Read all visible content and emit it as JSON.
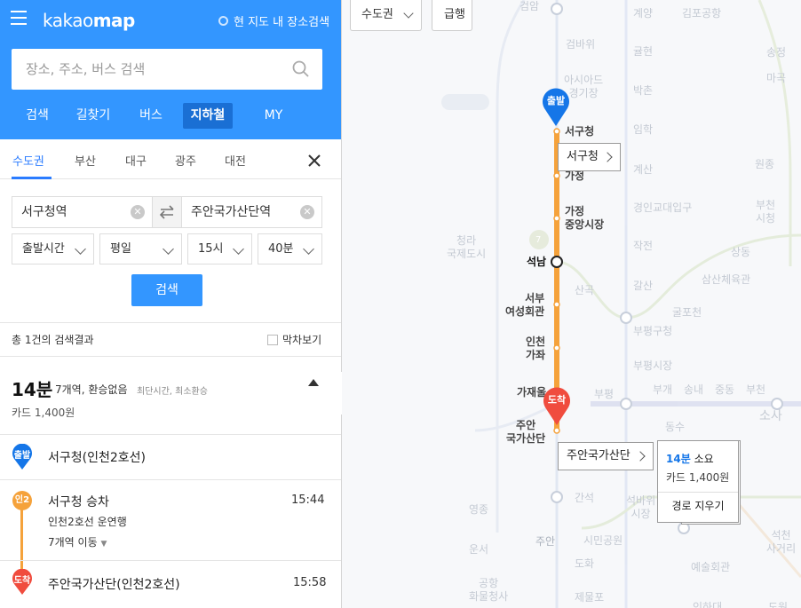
{
  "app": {
    "logo_prefix": "kakao",
    "logo_suffix": "map",
    "map_search_toggle": "현 지도 내 장소검색"
  },
  "search": {
    "placeholder": "장소, 주소, 버스 검색"
  },
  "nav_tabs": [
    {
      "label": "검색",
      "active": false
    },
    {
      "label": "길찾기",
      "active": false
    },
    {
      "label": "버스",
      "active": false
    },
    {
      "label": "지하철",
      "active": true
    },
    {
      "label": "MY",
      "active": false
    }
  ],
  "region_tabs": [
    {
      "label": "수도권",
      "active": true
    },
    {
      "label": "부산",
      "active": false
    },
    {
      "label": "대구",
      "active": false
    },
    {
      "label": "광주",
      "active": false
    },
    {
      "label": "대전",
      "active": false
    }
  ],
  "route": {
    "origin": "서구청역",
    "destination": "주안국가산단역"
  },
  "filters": {
    "time_type": "출발시간",
    "day_type": "평일",
    "hour": "15시",
    "minute": "40분"
  },
  "search_button": "검색",
  "results": {
    "count_text": "총 1건의 검색결과",
    "last_train_label": "막차보기"
  },
  "summary": {
    "duration": "14분",
    "detail": "7개역, 환승없음",
    "tags": "최단시간, 최소환승",
    "fare": "카드 1,400원"
  },
  "steps": {
    "start_badge": "출발",
    "start_station": "서구청(인천2호선)",
    "line_badge": "인2",
    "board_text": "서구청 승차",
    "board_time": "15:44",
    "line_info": "인천2호선 운연행",
    "stops_text": "7개역 이동",
    "end_badge": "도착",
    "end_station": "주안국가산단(인천2호선)",
    "end_time": "15:58"
  },
  "map": {
    "region_select": "수도권",
    "express_label": "급행",
    "origin_marker": "출발",
    "dest_marker": "도착",
    "origin_callout": "서구청",
    "dest_callout": "주안국가산단",
    "info_duration": "14분",
    "info_duration_suffix": "소요",
    "info_fare": "카드 1,400원",
    "clear_route": "경로 지우기",
    "route_stations": [
      "서구청",
      "가정",
      "가정\n중앙시장",
      "석남",
      "서부\n여성회관",
      "인천\n가좌",
      "가재울",
      "주안\n국가산단"
    ],
    "background_stations": [
      "검암",
      "계양",
      "김포공항",
      "검바위",
      "귤현",
      "아시아드\n경기장",
      "박촌",
      "임학",
      "계산",
      "경인교대입구",
      "작전",
      "갈산",
      "부평구청",
      "부평시장",
      "부평",
      "부개",
      "송내",
      "중동",
      "부천",
      "소사",
      "동수",
      "굴포천",
      "삼산체육관",
      "청라\n국제도시",
      "산곡",
      "간석",
      "석바위\n시장",
      "시민공원",
      "주안",
      "도화",
      "제물포",
      "예술회관",
      "석천\n사거리",
      "원종",
      "마곡",
      "송정",
      "부천\n시청",
      "상동",
      "운서",
      "영종",
      "공항\n화물청사",
      "인하대",
      "도원",
      "7"
    ],
    "colors": {
      "route_line": "#f5a23b",
      "origin_marker": "#1576e8",
      "dest_marker": "#f04c3e"
    }
  }
}
